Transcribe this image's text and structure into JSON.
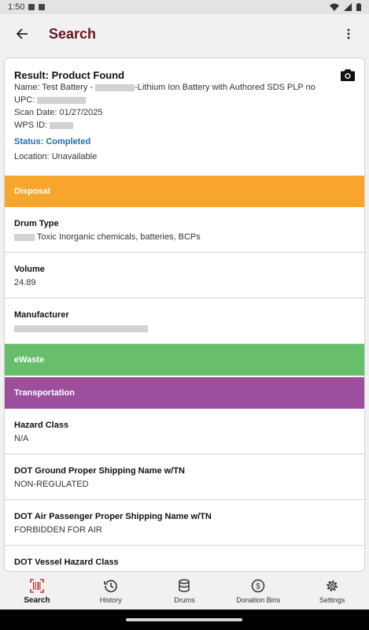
{
  "status_bar": {
    "time": "1:50"
  },
  "app_bar": {
    "title": "Search"
  },
  "result": {
    "title": "Result: Product Found",
    "name_prefix": "Name: Test Battery - ",
    "name_suffix": "-Lithium Ion Battery with Authored SDS PLP no",
    "upc_label": "UPC:",
    "scan_date": "Scan Date: 01/27/2025",
    "wps_label": "WPS ID:",
    "status": "Status: Completed",
    "location": "Location: Unavailable"
  },
  "sections": {
    "disposal": "Disposal",
    "ewaste": "eWaste",
    "transportation": "Transportation"
  },
  "disposal_fields": {
    "drum_type_label": "Drum Type",
    "drum_type_value": "Toxic Inorganic chemicals, batteries, BCPs",
    "volume_label": "Volume",
    "volume_value": "24.89",
    "manufacturer_label": "Manufacturer"
  },
  "transport_fields": {
    "hazard_class_label": "Hazard Class",
    "hazard_class_value": "N/A",
    "dot_ground_label": "DOT Ground Proper Shipping Name w/TN",
    "dot_ground_value": "NON-REGULATED",
    "dot_air_label": "DOT Air Passenger Proper Shipping Name w/TN",
    "dot_air_value": "FORBIDDEN FOR AIR",
    "dot_vessel_label": "DOT Vessel Hazard Class"
  },
  "bottom_nav": {
    "search": "Search",
    "history": "History",
    "drums": "Drums",
    "donation_bins": "Donation Bins",
    "settings": "Settings"
  },
  "colors": {
    "title": "#6a1426",
    "status": "#1e6ea8",
    "disposal": "#f8a52c",
    "ewaste": "#67bf6d",
    "transportation": "#9b4f9d",
    "active_nav_icon": "#c0392b"
  }
}
